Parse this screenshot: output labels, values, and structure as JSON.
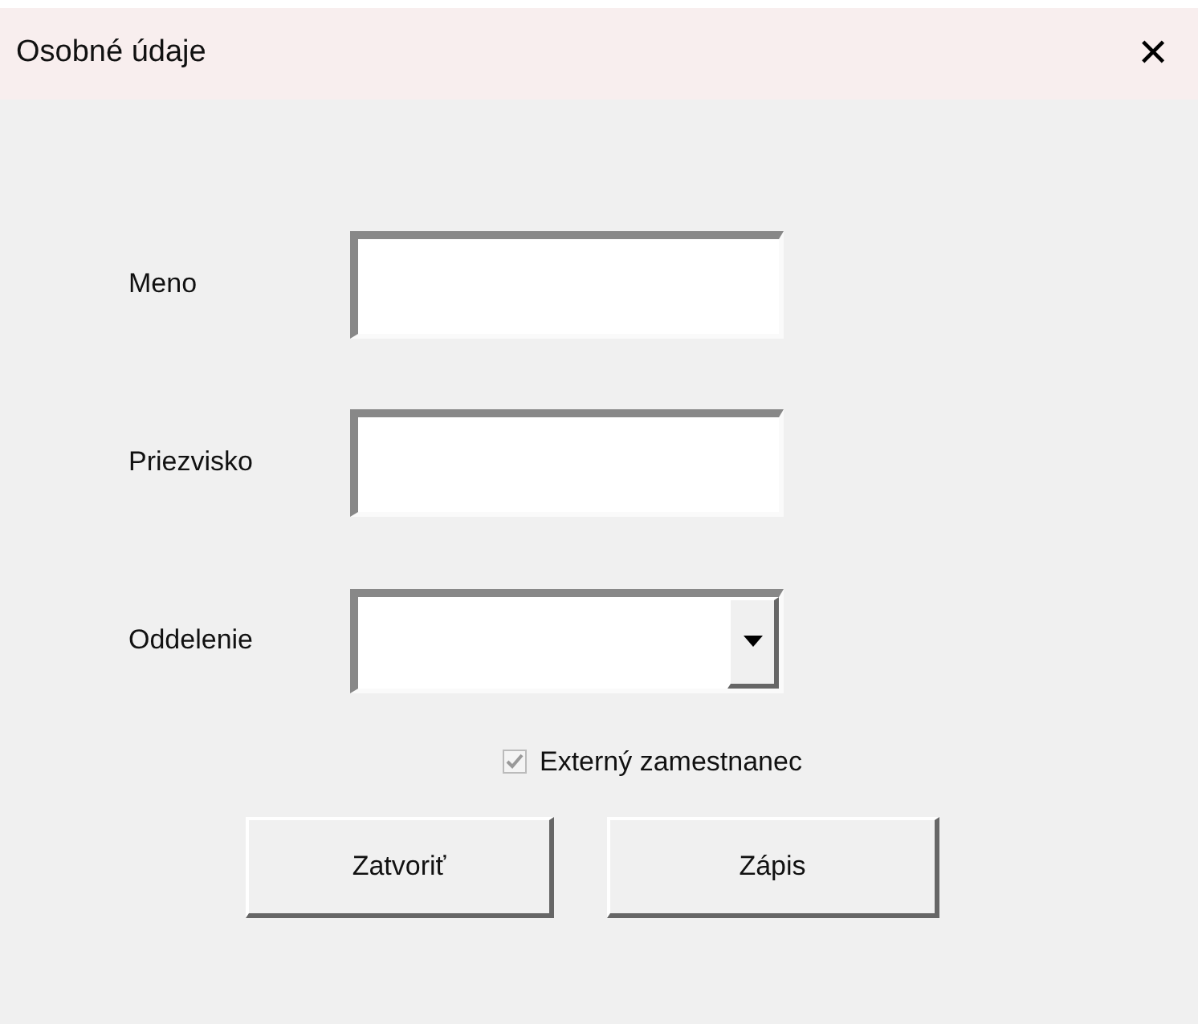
{
  "window": {
    "title": "Osobné údaje",
    "close": "✕"
  },
  "fields": [
    {
      "kind": "text",
      "label": "Meno"
    },
    {
      "kind": "text",
      "label": "Priezvisko"
    },
    {
      "kind": "dropdown",
      "label": "Oddelenie"
    }
  ],
  "checkbox": {
    "label": "Externý zamestnanec",
    "checked": true,
    "disabled": true
  },
  "buttons": [
    "Zatvoriť",
    "Zápis"
  ]
}
